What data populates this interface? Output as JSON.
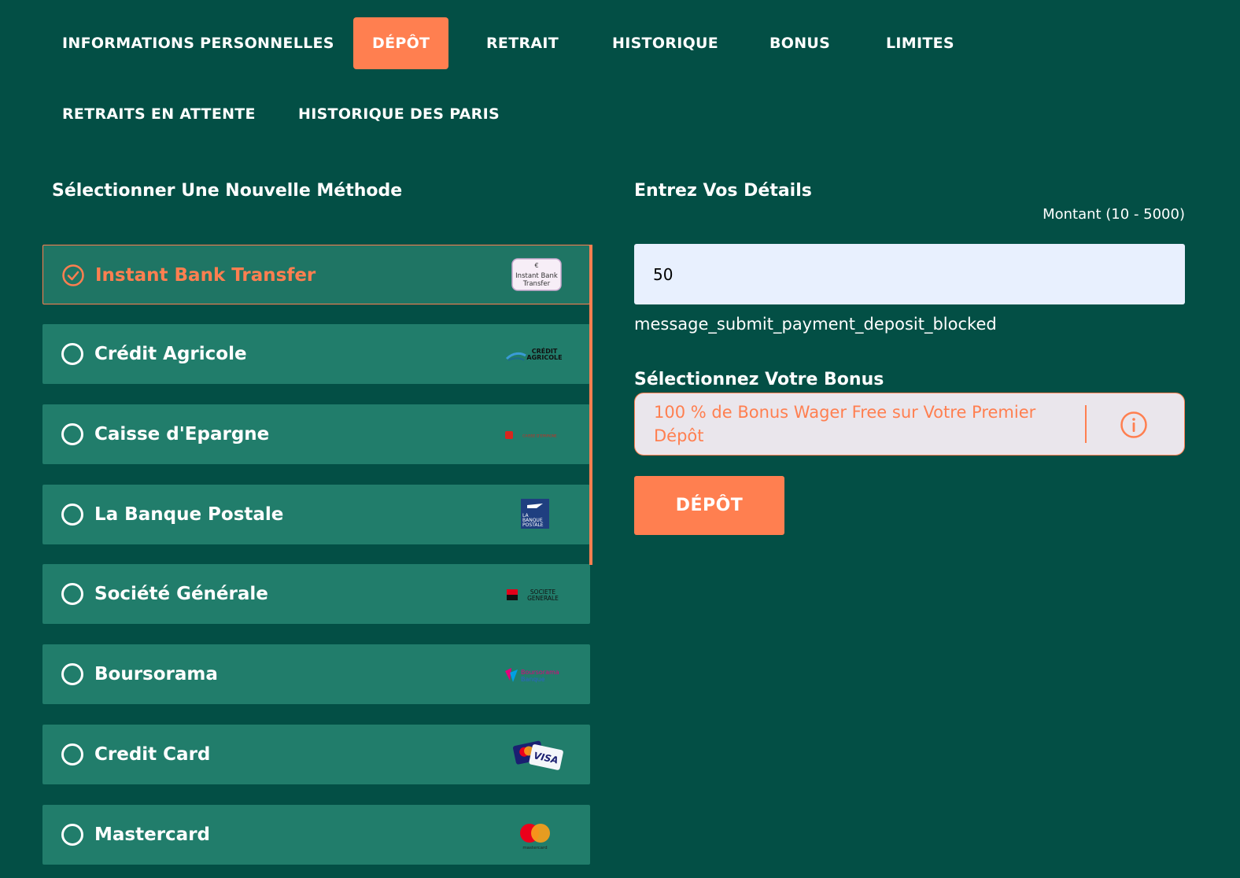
{
  "nav": {
    "tabs": [
      {
        "label": "INFORMATIONS PERSONNELLES"
      },
      {
        "label": "DÉPÔT"
      },
      {
        "label": "RETRAIT"
      },
      {
        "label": "HISTORIQUE"
      },
      {
        "label": "BONUS"
      },
      {
        "label": "LIMITES"
      },
      {
        "label": "RETRAITS EN ATTENTE"
      },
      {
        "label": "HISTORIQUE DES PARIS"
      }
    ],
    "active_tab": "DÉPÔT"
  },
  "methods_panel": {
    "title": "Sélectionner Une Nouvelle Méthode",
    "methods": [
      {
        "label": "Instant Bank Transfer",
        "logo": "instant-bank-transfer-logo",
        "logo_text": [
          "Instant Bank",
          "Transfer"
        ],
        "selected": true
      },
      {
        "label": "Crédit Agricole",
        "logo": "credit-agricole-logo",
        "logo_text": [
          "CRÉDIT",
          "AGRICOLE"
        ],
        "selected": false
      },
      {
        "label": "Caisse d'Epargne",
        "logo": "caisse-epargne-logo",
        "logo_text": [
          "CAISSE D'EPARGNE"
        ],
        "selected": false
      },
      {
        "label": "La Banque Postale",
        "logo": "la-banque-postale-logo",
        "logo_text": [
          "LA",
          "BANQUE",
          "POSTALE"
        ],
        "selected": false
      },
      {
        "label": "Société Générale",
        "logo": "societe-generale-logo",
        "logo_text": [
          "SOCIETE",
          "GENERALE"
        ],
        "selected": false
      },
      {
        "label": "Boursorama",
        "logo": "boursorama-logo",
        "logo_text": [
          "Boursorama",
          "Banque"
        ],
        "selected": false
      },
      {
        "label": "Credit Card",
        "logo": "credit-card-logo",
        "logo_text": [
          "VISA"
        ],
        "selected": false
      },
      {
        "label": "Mastercard",
        "logo": "mastercard-logo",
        "logo_text": [
          "mastercard"
        ],
        "selected": false
      }
    ]
  },
  "details_panel": {
    "title": "Entrez Vos Détails",
    "amount_label": "Montant (10 - 5000)",
    "amount_value": "50",
    "message": "message_submit_payment_deposit_blocked",
    "bonus_title": "Sélectionnez Votre Bonus",
    "bonus_selected": "100 % de Bonus Wager Free sur Votre Premier Dépôt",
    "submit_label": "DÉPÔT"
  },
  "colors": {
    "background": "#034f45",
    "card": "#217d6b",
    "accent": "#ff7f50",
    "input_bg": "#e8f0fe"
  }
}
